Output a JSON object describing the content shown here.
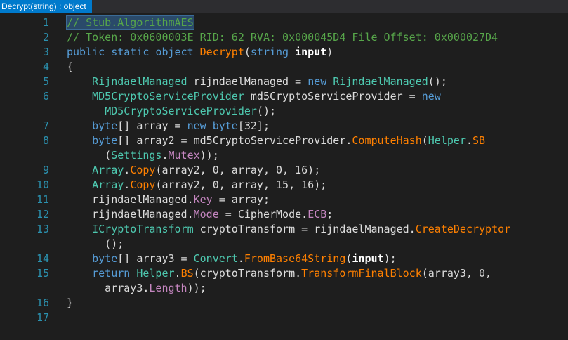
{
  "tab": {
    "title": "Decrypt(string) : object"
  },
  "editor": {
    "lines": [
      {
        "num": "1",
        "tokens": [
          {
            "t": "// Stub.AlgorithmAES",
            "c": "cm sel"
          }
        ]
      },
      {
        "num": "2",
        "tokens": [
          {
            "t": "// Token: 0x0600003E RID: 62 RVA: 0x000045D4 File Offset: 0x000027D4",
            "c": "cm"
          }
        ]
      },
      {
        "num": "3",
        "tokens": [
          {
            "t": "public",
            "c": "kw"
          },
          {
            "t": " ",
            "c": "tx"
          },
          {
            "t": "static",
            "c": "kw"
          },
          {
            "t": " ",
            "c": "tx"
          },
          {
            "t": "object",
            "c": "kw"
          },
          {
            "t": " ",
            "c": "tx"
          },
          {
            "t": "Decrypt",
            "c": "mt"
          },
          {
            "t": "(",
            "c": "tx"
          },
          {
            "t": "string",
            "c": "kw"
          },
          {
            "t": " ",
            "c": "tx"
          },
          {
            "t": "input",
            "c": "bold"
          },
          {
            "t": ")",
            "c": "tx"
          }
        ]
      },
      {
        "num": "4",
        "tokens": [
          {
            "t": "{",
            "c": "tx"
          }
        ]
      },
      {
        "num": "5",
        "tokens": [
          {
            "t": "    ",
            "c": "tx"
          },
          {
            "t": "RijndaelManaged",
            "c": "ty"
          },
          {
            "t": " rijndaelManaged = ",
            "c": "tx"
          },
          {
            "t": "new",
            "c": "kw"
          },
          {
            "t": " ",
            "c": "tx"
          },
          {
            "t": "RijndaelManaged",
            "c": "ty"
          },
          {
            "t": "();",
            "c": "tx"
          }
        ]
      },
      {
        "num": "6",
        "tokens": [
          {
            "t": "    ",
            "c": "tx"
          },
          {
            "t": "MD5CryptoServiceProvider",
            "c": "ty"
          },
          {
            "t": " md5CryptoServiceProvider = ",
            "c": "tx"
          },
          {
            "t": "new",
            "c": "kw"
          }
        ]
      },
      {
        "num": "",
        "tokens": [
          {
            "t": "      ",
            "c": "tx"
          },
          {
            "t": "MD5CryptoServiceProvider",
            "c": "ty"
          },
          {
            "t": "();",
            "c": "tx"
          }
        ]
      },
      {
        "num": "7",
        "tokens": [
          {
            "t": "    ",
            "c": "tx"
          },
          {
            "t": "byte",
            "c": "kw"
          },
          {
            "t": "[] array = ",
            "c": "tx"
          },
          {
            "t": "new",
            "c": "kw"
          },
          {
            "t": " ",
            "c": "tx"
          },
          {
            "t": "byte",
            "c": "kw"
          },
          {
            "t": "[32];",
            "c": "tx"
          }
        ]
      },
      {
        "num": "8",
        "tokens": [
          {
            "t": "    ",
            "c": "tx"
          },
          {
            "t": "byte",
            "c": "kw"
          },
          {
            "t": "[] array2 = md5CryptoServiceProvider.",
            "c": "tx"
          },
          {
            "t": "ComputeHash",
            "c": "mt"
          },
          {
            "t": "(",
            "c": "tx"
          },
          {
            "t": "Helper",
            "c": "ty"
          },
          {
            "t": ".",
            "c": "tx"
          },
          {
            "t": "SB",
            "c": "mt"
          }
        ]
      },
      {
        "num": "",
        "tokens": [
          {
            "t": "      (",
            "c": "tx"
          },
          {
            "t": "Settings",
            "c": "ty"
          },
          {
            "t": ".",
            "c": "tx"
          },
          {
            "t": "Mutex",
            "c": "pr"
          },
          {
            "t": "));",
            "c": "tx"
          }
        ]
      },
      {
        "num": "9",
        "tokens": [
          {
            "t": "    ",
            "c": "tx"
          },
          {
            "t": "Array",
            "c": "ty"
          },
          {
            "t": ".",
            "c": "tx"
          },
          {
            "t": "Copy",
            "c": "mt"
          },
          {
            "t": "(array2, 0, array, 0, 16);",
            "c": "tx"
          }
        ]
      },
      {
        "num": "10",
        "tokens": [
          {
            "t": "    ",
            "c": "tx"
          },
          {
            "t": "Array",
            "c": "ty"
          },
          {
            "t": ".",
            "c": "tx"
          },
          {
            "t": "Copy",
            "c": "mt"
          },
          {
            "t": "(array2, 0, array, 15, 16);",
            "c": "tx"
          }
        ]
      },
      {
        "num": "11",
        "tokens": [
          {
            "t": "    rijndaelManaged.",
            "c": "tx"
          },
          {
            "t": "Key",
            "c": "pr"
          },
          {
            "t": " = array;",
            "c": "tx"
          }
        ]
      },
      {
        "num": "12",
        "tokens": [
          {
            "t": "    rijndaelManaged.",
            "c": "tx"
          },
          {
            "t": "Mode",
            "c": "pr"
          },
          {
            "t": " = CipherMode.",
            "c": "tx"
          },
          {
            "t": "ECB",
            "c": "pr"
          },
          {
            "t": ";",
            "c": "tx"
          }
        ]
      },
      {
        "num": "13",
        "tokens": [
          {
            "t": "    ",
            "c": "tx"
          },
          {
            "t": "ICryptoTransform",
            "c": "ty"
          },
          {
            "t": " cryptoTransform = rijndaelManaged.",
            "c": "tx"
          },
          {
            "t": "CreateDecryptor",
            "c": "mt"
          }
        ]
      },
      {
        "num": "",
        "tokens": [
          {
            "t": "      ();",
            "c": "tx"
          }
        ]
      },
      {
        "num": "14",
        "tokens": [
          {
            "t": "    ",
            "c": "tx"
          },
          {
            "t": "byte",
            "c": "kw"
          },
          {
            "t": "[] array3 = ",
            "c": "tx"
          },
          {
            "t": "Convert",
            "c": "ty"
          },
          {
            "t": ".",
            "c": "tx"
          },
          {
            "t": "FromBase64String",
            "c": "mt"
          },
          {
            "t": "(",
            "c": "tx"
          },
          {
            "t": "input",
            "c": "bold"
          },
          {
            "t": ");",
            "c": "tx"
          }
        ]
      },
      {
        "num": "15",
        "tokens": [
          {
            "t": "    ",
            "c": "tx"
          },
          {
            "t": "return",
            "c": "kw"
          },
          {
            "t": " ",
            "c": "tx"
          },
          {
            "t": "Helper",
            "c": "ty"
          },
          {
            "t": ".",
            "c": "tx"
          },
          {
            "t": "BS",
            "c": "mt"
          },
          {
            "t": "(cryptoTransform.",
            "c": "tx"
          },
          {
            "t": "TransformFinalBlock",
            "c": "mt"
          },
          {
            "t": "(array3, 0,",
            "c": "tx"
          }
        ]
      },
      {
        "num": "",
        "tokens": [
          {
            "t": "      array3.",
            "c": "tx"
          },
          {
            "t": "Length",
            "c": "pr"
          },
          {
            "t": "));",
            "c": "tx"
          }
        ]
      },
      {
        "num": "16",
        "tokens": [
          {
            "t": "}",
            "c": "tx"
          }
        ]
      },
      {
        "num": "17",
        "tokens": []
      }
    ]
  }
}
